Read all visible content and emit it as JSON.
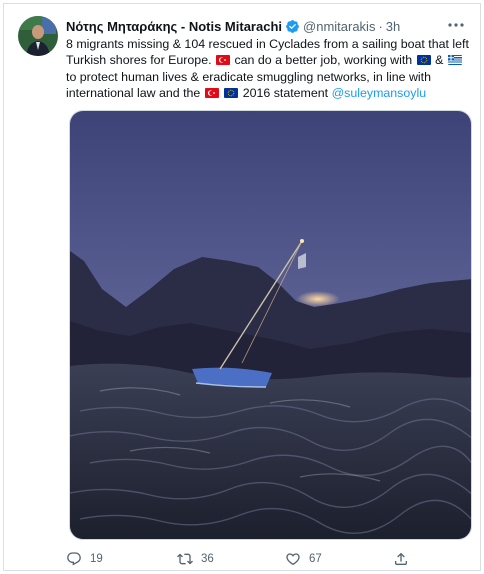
{
  "tweet": {
    "author_name": "Νότης Μηταράκης - Notis Mitarachi",
    "handle": "@nmitarakis",
    "separator": "·",
    "time": "3h",
    "text": {
      "part1": "8 migrants missing & 104 rescued in Cyclades from a sailing boat that left Turkish shores for Europe.",
      "part2": "can do a better job, working with",
      "part3": "&",
      "part4": "to protect human lives & eradicate smuggling networks, in line with international law and the",
      "part5": "2016  statement",
      "mention": "@suleymansoylu"
    },
    "flags": {
      "turkey": "flag-turkey",
      "eu": "flag-eu",
      "greece": "flag-greece"
    },
    "media_alt": "",
    "counts": {
      "replies": "19",
      "retweets": "36",
      "likes": "67"
    }
  },
  "colors": {
    "accent": "#1d9bf0",
    "text": "#0f1419",
    "muted": "#536471"
  },
  "icons": {
    "verified": "verified-badge-icon",
    "more": "more-icon",
    "reply": "reply-icon",
    "retweet": "retweet-icon",
    "like": "heart-icon",
    "share": "share-icon"
  }
}
